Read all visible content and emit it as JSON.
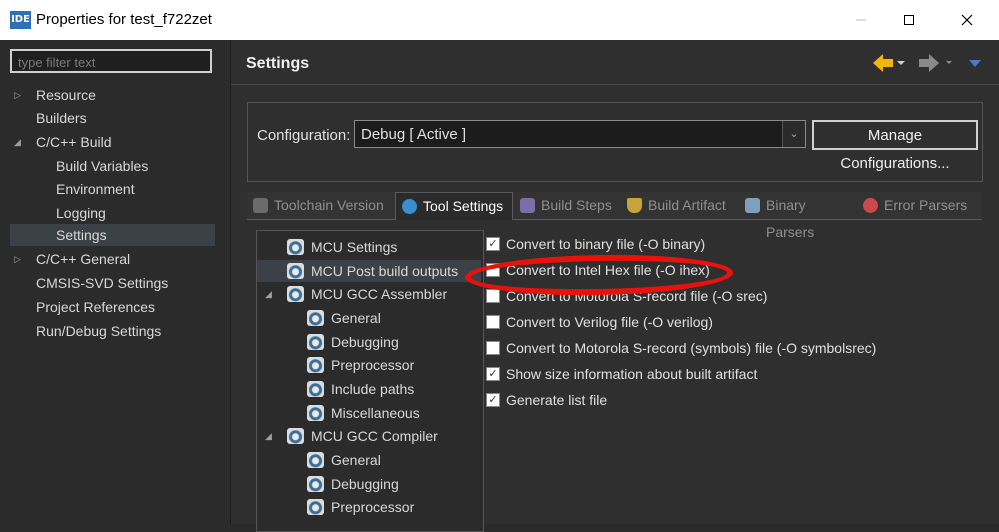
{
  "window": {
    "icon_text": "IDE",
    "title": "Properties for test_f722zet",
    "controls": {
      "minimize": "minimize-icon",
      "maximize": "maximize-icon",
      "close": "close-icon"
    }
  },
  "left": {
    "filter_placeholder": "type filter text",
    "tree": [
      {
        "label": "Resource",
        "twisty": "▷"
      },
      {
        "label": "Builders",
        "twisty": ""
      },
      {
        "label": "C/C++ Build",
        "twisty": "◢"
      },
      {
        "label": "Build Variables",
        "twisty": ""
      },
      {
        "label": "Environment",
        "twisty": ""
      },
      {
        "label": "Logging",
        "twisty": ""
      },
      {
        "label": "Settings",
        "twisty": ""
      },
      {
        "label": "C/C++ General",
        "twisty": "▷"
      },
      {
        "label": "CMSIS-SVD Settings",
        "twisty": ""
      },
      {
        "label": "Project References",
        "twisty": ""
      },
      {
        "label": "Run/Debug Settings",
        "twisty": ""
      }
    ]
  },
  "right": {
    "title": "Settings",
    "config_label": "Configuration:",
    "config_value": "Debug  [ Active ]",
    "manage_button": "Manage Configurations...",
    "tabs": [
      {
        "label": "Toolchain Version",
        "color": "#6b6b6b"
      },
      {
        "label": "Tool Settings",
        "color": "#3a8ed0"
      },
      {
        "label": "Build Steps",
        "color": "#7a6ea8"
      },
      {
        "label": "Build Artifact",
        "color": "#c8a23a"
      },
      {
        "label": "Binary Parsers",
        "color": "#7f9fbf"
      },
      {
        "label": "Error Parsers",
        "color": "#c84a4a"
      }
    ],
    "tool_tree": [
      {
        "label": "MCU Settings",
        "twisty": ""
      },
      {
        "label": "MCU Post build outputs",
        "twisty": ""
      },
      {
        "label": "MCU GCC Assembler",
        "twisty": "◢"
      },
      {
        "label": "General",
        "twisty": ""
      },
      {
        "label": "Debugging",
        "twisty": ""
      },
      {
        "label": "Preprocessor",
        "twisty": ""
      },
      {
        "label": "Include paths",
        "twisty": ""
      },
      {
        "label": "Miscellaneous",
        "twisty": ""
      },
      {
        "label": "MCU GCC Compiler",
        "twisty": "◢"
      },
      {
        "label": "General",
        "twisty": ""
      },
      {
        "label": "Debugging",
        "twisty": ""
      },
      {
        "label": "Preprocessor",
        "twisty": ""
      }
    ],
    "options": [
      {
        "label": "Convert to binary file (-O binary)",
        "checked": "✓"
      },
      {
        "label": "Convert to Intel Hex file (-O ihex)",
        "checked": ""
      },
      {
        "label": "Convert to Motorola S-record file (-O srec)",
        "checked": ""
      },
      {
        "label": "Convert to Verilog file (-O verilog)",
        "checked": ""
      },
      {
        "label": "Convert to Motorola S-record (symbols) file (-O symbolsrec)",
        "checked": ""
      },
      {
        "label": "Show size information about built artifact",
        "checked": "✓"
      },
      {
        "label": "Generate list file",
        "checked": "✓"
      }
    ]
  },
  "colors": {
    "accent_yellow": "#f2b705",
    "annotation_red": "#e8120c",
    "nav_blue": "#4a78d0"
  }
}
